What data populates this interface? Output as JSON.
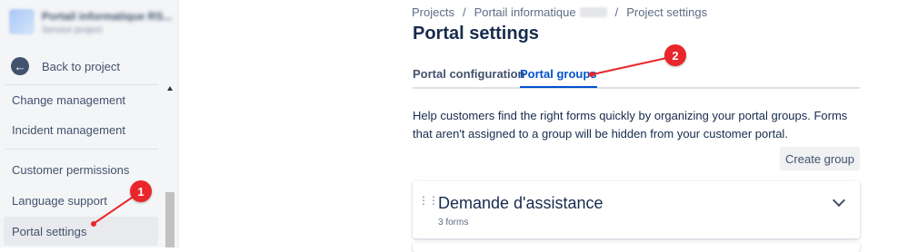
{
  "sidebar": {
    "project_name": "Portail informatique RS...",
    "project_type": "Service project",
    "back_label": "Back to project",
    "items": [
      {
        "label": "Change management"
      },
      {
        "label": "Incident management"
      },
      {
        "label": "Customer permissions"
      },
      {
        "label": "Language support"
      },
      {
        "label": "Portal settings",
        "active": true
      }
    ]
  },
  "breadcrumb": {
    "items": [
      "Projects",
      "Portail informatique",
      "Project settings"
    ],
    "separator": "/"
  },
  "page": {
    "title": "Portal settings",
    "help_text": "Help customers find the right forms quickly by organizing your portal groups. Forms that aren't assigned to a group will be hidden from your customer portal.",
    "create_group_label": "Create group"
  },
  "tabs": [
    {
      "label": "Portal configuration",
      "active": false
    },
    {
      "label": "Portal groups",
      "active": true
    }
  ],
  "groups": [
    {
      "title": "Demande d'assistance",
      "count": "3 forms"
    }
  ],
  "annotations": {
    "marker_1": "1",
    "marker_2": "2",
    "color": "#e8262b"
  },
  "colors": {
    "accent": "#0052cc",
    "sidebar_bg": "#f4f5f7",
    "text": "#172b4d"
  },
  "icons": {
    "back": "arrow-left-circle-icon",
    "drag": "drag-handle-icon",
    "expand": "chevron-down-icon"
  }
}
